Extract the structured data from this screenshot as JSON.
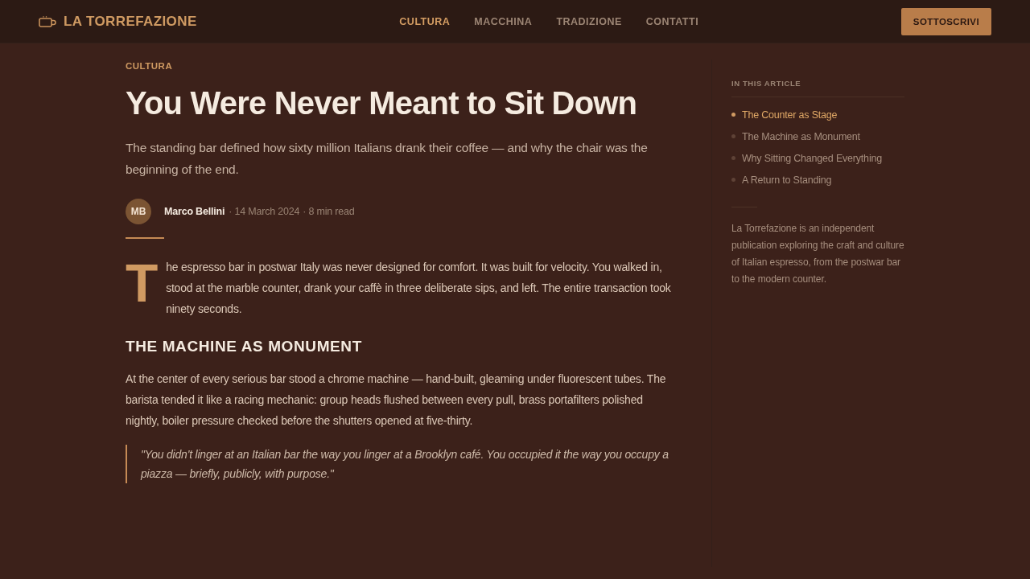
{
  "header": {
    "logo": "LA TORREFAZIONE",
    "nav": [
      {
        "label": "CULTURA",
        "selected": true
      },
      {
        "label": "MACCHINA",
        "selected": false
      },
      {
        "label": "TRADIZIONE",
        "selected": false
      },
      {
        "label": "CONTATTI",
        "selected": false
      }
    ],
    "subscribe_button": "SOTTOSCRIVI"
  },
  "article": {
    "category": "CULTURA",
    "title": "You Were Never Meant to Sit Down",
    "subtitle": "The standing bar defined how sixty million Italians drank their coffee — and why the chair was the beginning of the end.",
    "author": {
      "initials": "MB",
      "name": "Marco Bellini"
    },
    "date": "· 14 March 2024",
    "read_time": "· 8 min read",
    "body": [
      {
        "kind": "paragraph",
        "drop_cap": true,
        "text": "The espresso bar in postwar Italy was never designed for comfort. It was built for velocity. You walked in, stood at the marble counter, drank your caffè in three deliberate sips, and left. The entire transaction took ninety seconds."
      },
      {
        "kind": "heading",
        "text": "THE MACHINE AS MONUMENT"
      },
      {
        "kind": "paragraph",
        "drop_cap": false,
        "text": "At the center of every serious bar stood a chrome machine — hand-built, gleaming under fluorescent tubes. The barista tended it like a racing mechanic: group heads flushed between every pull, brass portafilters polished nightly, boiler pressure checked before the shutters opened at five-thirty."
      },
      {
        "kind": "quote",
        "text": "\"You didn't linger at an Italian bar the way you linger at a Brooklyn café. You occupied it the way you occupy a piazza — briefly, publicly, with purpose.\""
      }
    ]
  },
  "sidebar": {
    "toc_heading": "IN THIS ARTICLE",
    "toc": [
      {
        "label": "The Counter as Stage",
        "selected": true
      },
      {
        "label": "The Machine as Monument",
        "selected": false
      },
      {
        "label": "Why Sitting Changed Everything",
        "selected": false
      },
      {
        "label": "A Return to Standing",
        "selected": false
      }
    ],
    "about": "La Torrefazione is an independent publication exploring the craft and culture of Italian espresso, from the postwar bar to the modern counter."
  }
}
